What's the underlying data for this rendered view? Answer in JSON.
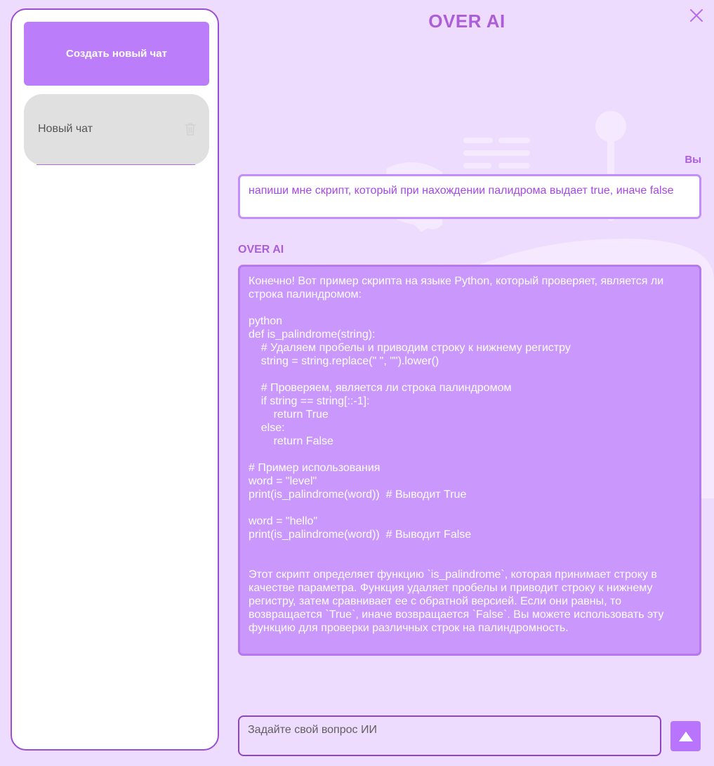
{
  "app": {
    "title": "OVER AI"
  },
  "sidebar": {
    "new_chat_label": "Создать новый чат",
    "chats": [
      {
        "label": "Новый чат"
      }
    ]
  },
  "conversation": {
    "user_label": "Вы",
    "user_message": "напиши мне скрипт, который при нахождении палидрома выдает true, иначе false",
    "ai_label": "OVER AI",
    "ai_message": "Конечно! Вот пример скрипта на языке Python, который проверяет, является ли строка палиндромом:\n\npython\ndef is_palindrome(string):\n    # Удаляем пробелы и приводим строку к нижнему регистру\n    string = string.replace(\" \", \"\").lower()\n\n    # Проверяем, является ли строка палиндромом\n    if string == string[::-1]:\n        return True\n    else:\n        return False\n\n# Пример использования\nword = \"level\"\nprint(is_palindrome(word))  # Выводит True\n\nword = \"hello\"\nprint(is_palindrome(word))  # Выводит False\n\n\nЭтот скрипт определяет функцию `is_palindrome`, которая принимает строку в качестве параметра. Функция удаляет пробелы и приводит строку к нижнему регистру, затем сравнивает ее с обратной версией. Если они равны, то возвращается `True`, иначе возвращается `False`. Вы можете использовать эту функцию для проверки различных строк на палиндромность."
  },
  "composer": {
    "placeholder": "Задайте свой вопрос ИИ",
    "value": ""
  },
  "icons": {
    "close": "close-icon",
    "trash": "trash-icon",
    "send": "send-arrow-icon"
  },
  "colors": {
    "background": "#eedcfe",
    "accent": "#bc7dfb",
    "ai_bubble": "#ca97fd",
    "title": "#ac5ed8",
    "sidebar_border": "#9a4fd0"
  }
}
